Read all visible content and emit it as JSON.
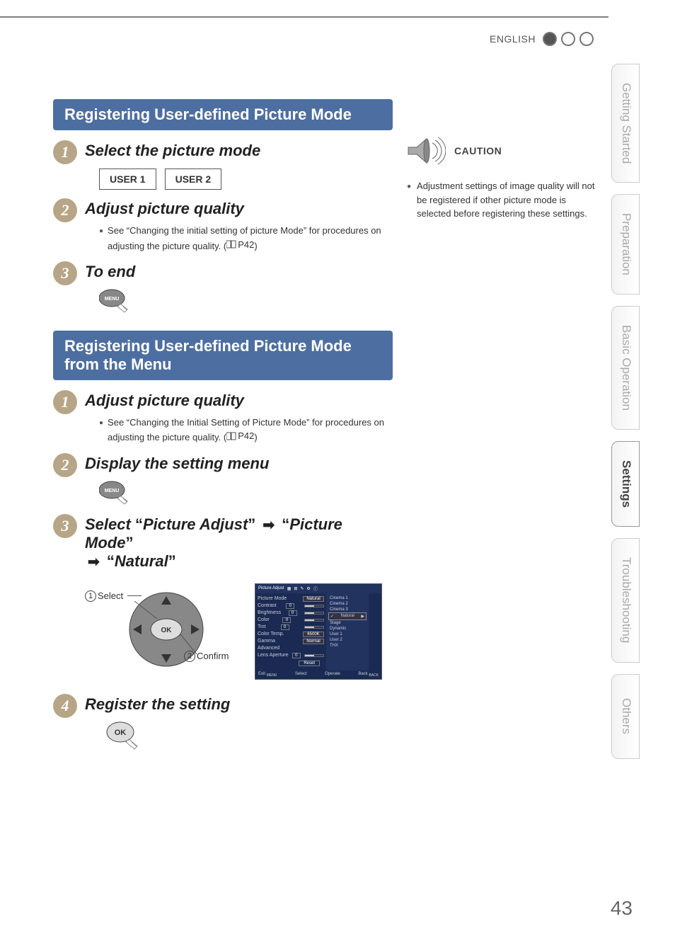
{
  "page_number": "43",
  "language_label": "ENGLISH",
  "side_tabs": [
    "Getting Started",
    "Preparation",
    "Basic Operation",
    "Settings",
    "Troubleshooting",
    "Others"
  ],
  "active_tab_index": 3,
  "section1": {
    "title": "Registering User-defined Picture Mode",
    "step1": {
      "title": "Select the picture mode",
      "buttons": [
        "USER 1",
        "USER 2"
      ]
    },
    "step2": {
      "title": "Adjust picture quality",
      "note_pre": "See “Changing the initial setting of picture Mode” for procedures on adjusting the picture quality. (",
      "note_ref": "P42",
      "note_post": ")"
    },
    "step3": {
      "title": "To end",
      "key_label": "MENU"
    }
  },
  "section2": {
    "title": "Registering User-defined Picture Mode from the Menu",
    "step1": {
      "title": "Adjust picture quality",
      "note_pre": "See “Changing the Initial Setting of Picture Mode” for procedures on adjusting the picture quality. (",
      "note_ref": "P42",
      "note_post": ")"
    },
    "step2": {
      "title": "Display the setting menu",
      "key_label": "MENU"
    },
    "step3": {
      "prefix": "Select",
      "path1": "Picture Adjust",
      "path2": "Picture Mode",
      "path3": "Natural"
    },
    "diagram": {
      "select_label": "Select",
      "confirm_label": "Confirm",
      "ok_label": "OK"
    },
    "osd": {
      "tab": "Picture Adjust",
      "rows": [
        {
          "label": "Picture Mode",
          "value": "Natural"
        },
        {
          "label": "Contrast",
          "num": "0"
        },
        {
          "label": "Brightness",
          "num": "0"
        },
        {
          "label": "Color",
          "num": "0"
        },
        {
          "label": "Tint",
          "num": "0"
        },
        {
          "label": "Color Temp.",
          "value": "6500K"
        },
        {
          "label": "Gamma",
          "value": "Normal"
        },
        {
          "label": "Advanced",
          "value": ""
        },
        {
          "label": "Lens Aperture",
          "num": "0"
        }
      ],
      "options": [
        "Cinema 1",
        "Cinema 2",
        "Cinema 3",
        "Natural",
        "Stage",
        "Dynamic",
        "User 1",
        "User 2",
        "THX"
      ],
      "selected_option": "Natural",
      "reset": "Reset",
      "footer_exit": "Exit",
      "footer_exit_sub": "MENU",
      "footer_select": "Select",
      "footer_operate": "Operate",
      "footer_back": "Back",
      "footer_back_sub": "BACK"
    },
    "step4": {
      "title": "Register the setting",
      "key_label": "OK"
    }
  },
  "caution": {
    "label": "CAUTION",
    "text": "Adjustment settings of image quality will not be registered if other picture mode is selected before registering these settings."
  }
}
